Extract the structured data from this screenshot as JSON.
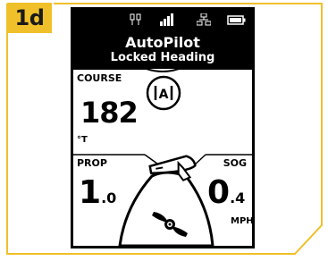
{
  "badge": "1d",
  "header": {
    "title": "AutoPilot",
    "subtitle": "Locked Heading"
  },
  "course": {
    "label": "COURSE",
    "value": "182",
    "unit": "°T"
  },
  "prop": {
    "label": "PROP",
    "value_int": "1",
    "value_dec": ".0"
  },
  "sog": {
    "label": "SOG",
    "value_int": "0",
    "value_dec": ".4",
    "unit": "MPH"
  },
  "lock_symbol": "A",
  "colors": {
    "badge": "#f0c02a",
    "frame_border": "#f0c02a",
    "screen_bg": "#ffffff",
    "header_bg": "#000000"
  },
  "icons": [
    "gps-icon",
    "signal-bars-icon",
    "network-icon",
    "battery-icon",
    "boat-heading-icon",
    "propeller-icon",
    "lock-heading-icon"
  ]
}
